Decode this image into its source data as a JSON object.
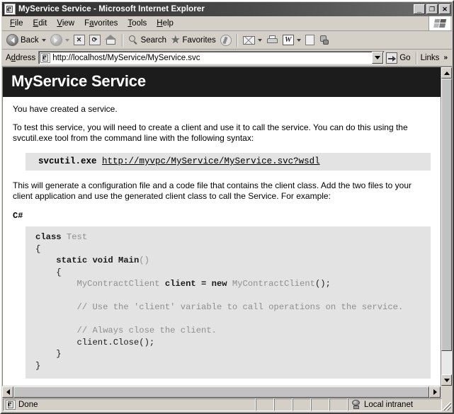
{
  "window": {
    "title": "MyService Service - Microsoft Internet Explorer",
    "icon": "ie-document-icon",
    "minimize_label": "_",
    "maximize_label": "❐",
    "close_label": "✕"
  },
  "menubar": {
    "items": [
      {
        "label": "File",
        "accel": "F"
      },
      {
        "label": "Edit",
        "accel": "E"
      },
      {
        "label": "View",
        "accel": "V"
      },
      {
        "label": "Favorites",
        "accel": "a"
      },
      {
        "label": "Tools",
        "accel": "T"
      },
      {
        "label": "Help",
        "accel": "H"
      }
    ],
    "logo": "windows-flag-icon"
  },
  "toolbar": {
    "back_label": "Back",
    "search_label": "Search",
    "favorites_label": "Favorites",
    "icons": {
      "back": "back-arrow-icon",
      "forward": "forward-arrow-icon",
      "stop": "stop-icon",
      "refresh": "refresh-icon",
      "home": "home-icon",
      "search": "magnifier-icon",
      "favorites": "star-icon",
      "media": "media-icon",
      "mail": "mail-icon",
      "print": "printer-icon",
      "edit": "word-edit-icon",
      "discuss": "blank-page-icon",
      "messenger": "messenger-icon"
    }
  },
  "addressbar": {
    "label": "Address",
    "url": "http://localhost/MyService/MyService.svc",
    "go_label": "Go",
    "links_label": "Links",
    "chevron": "»"
  },
  "page": {
    "banner_title": "MyService Service",
    "intro": "You have created a service.",
    "instructions": "To test this service, you will need to create a client and use it to call the service. You can do this using the svcutil.exe tool from the command line with the following syntax:",
    "command": {
      "tool": "svcutil.exe",
      "url": "http://myvpc/MyService/MyService.svc?wsdl"
    },
    "generated_note": "This will generate a configuration file and a code file that contains the client class. Add the two files to your client application and use the generated client class to call the Service. For example:",
    "language_label": "C#",
    "code_lines": [
      {
        "tokens": [
          {
            "t": "class ",
            "c": "kw"
          },
          {
            "t": "Test",
            "c": "id"
          }
        ]
      },
      {
        "tokens": [
          {
            "t": "{",
            "c": "pl"
          }
        ]
      },
      {
        "tokens": [
          {
            "t": "    static void ",
            "c": "kw"
          },
          {
            "t": "Main",
            "c": "kw"
          },
          {
            "t": "()",
            "c": "id"
          }
        ]
      },
      {
        "tokens": [
          {
            "t": "    {",
            "c": "pl"
          }
        ]
      },
      {
        "tokens": [
          {
            "t": "        MyContractClient ",
            "c": "id"
          },
          {
            "t": "client = new ",
            "c": "kw"
          },
          {
            "t": "MyContractClient",
            "c": "id"
          },
          {
            "t": "();",
            "c": "pl"
          }
        ]
      },
      {
        "tokens": [
          {
            "t": " ",
            "c": "pl"
          }
        ]
      },
      {
        "tokens": [
          {
            "t": "        // Use the 'client' variable to call operations on the service.",
            "c": "cm"
          }
        ]
      },
      {
        "tokens": [
          {
            "t": " ",
            "c": "pl"
          }
        ]
      },
      {
        "tokens": [
          {
            "t": "        // Always close the client.",
            "c": "cm"
          }
        ]
      },
      {
        "tokens": [
          {
            "t": "        client.Close();",
            "c": "pl"
          }
        ]
      },
      {
        "tokens": [
          {
            "t": "    }",
            "c": "pl"
          }
        ]
      },
      {
        "tokens": [
          {
            "t": "}",
            "c": "pl"
          }
        ]
      }
    ]
  },
  "statusbar": {
    "status_text": "Done",
    "zone_text": "Local intranet",
    "status_icon": "ie-document-icon",
    "zone_icon": "network-zone-icon"
  },
  "colors": {
    "banner_background": "#1c1c1c",
    "banner_text": "#ffffff",
    "code_background": "#e3e3e3",
    "chrome": "#d4d0c8",
    "page_background": "#ffffff"
  }
}
